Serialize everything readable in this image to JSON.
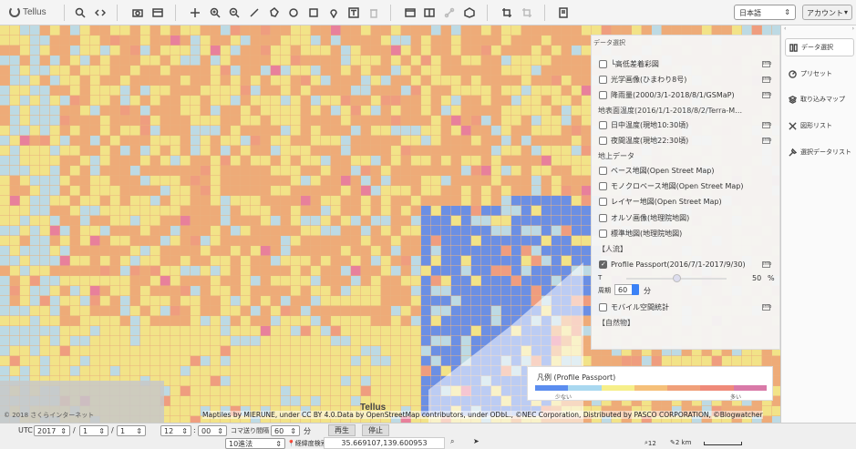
{
  "app": {
    "logo_text": "Tellus"
  },
  "toolbar": {
    "language": "日本語",
    "account": "アカウント"
  },
  "panel": {
    "title": "データ選択",
    "items": [
      {
        "label": "└高低差着彩図",
        "checked": false,
        "info": true
      },
      {
        "label": "光学画像(ひまわり8号)",
        "checked": false,
        "info": true
      },
      {
        "label": "降雨量(2000/3/1-2018/8/1/GSMaP)",
        "checked": false,
        "info": true
      }
    ],
    "section_surface_temp": "地表面温度(2016/1/1-2018/8/2/Terra-M…",
    "temp_items": [
      {
        "label": "日中温度(現地10:30頃)",
        "checked": false,
        "info": true
      },
      {
        "label": "夜間温度(現地22:30頃)",
        "checked": false,
        "info": true
      }
    ],
    "section_ground": "地上データ",
    "ground_items": [
      {
        "label": "ベース地図(Open Street Map)",
        "checked": false
      },
      {
        "label": "モノクロベース地図(Open Street Map)",
        "checked": false
      },
      {
        "label": "レイヤー地図(Open Street Map)",
        "checked": false
      },
      {
        "label": "オルソ画像(地理院地図)",
        "checked": false
      },
      {
        "label": "標準地図(地理院地図)",
        "checked": false
      }
    ],
    "section_people": "【人流】",
    "people_item": {
      "label": "Profile Passport(2016/7/1-2017/9/30)",
      "checked": true,
      "info": true
    },
    "opacity_label": "T",
    "opacity_value": "50",
    "opacity_unit": "%",
    "opacity_level": 0.5,
    "period_label": "周期",
    "period_value": "60",
    "period_unit": "分",
    "mobile_item": {
      "label": "モバイル空間統計",
      "checked": false,
      "info": true
    },
    "section_nature": "【自然物】"
  },
  "legend": {
    "title": "凡例 (Profile Passport)",
    "min_label": "少ない",
    "max_label": "多い",
    "colors": [
      "#5b8def",
      "#a9d8f0",
      "#f6ef8a",
      "#f5c07a",
      "#f0a07a",
      "#ef8a7a",
      "#d97aa8"
    ]
  },
  "sidebar": {
    "items": [
      {
        "label": "データ選択",
        "icon": "data-select-icon"
      },
      {
        "label": "プリセット",
        "icon": "preset-icon"
      },
      {
        "label": "取り込みマップ",
        "icon": "layers-icon"
      },
      {
        "label": "図形リスト",
        "icon": "shape-list-icon"
      },
      {
        "label": "選択データリスト",
        "icon": "pin-list-icon"
      }
    ]
  },
  "map": {
    "copyright": "© 2018 さくらインターネット",
    "attribution": "Maptiles by MIERUNE, under CC BY 4.0.Data by OpenStreetMap contributors, under ODbL., ©NEC Corporation, Distributed by PASCO CORPORATION, ©Blogwatcher",
    "watermark": "Tellus"
  },
  "bottom": {
    "utc": "UTC",
    "year": "2017",
    "month": "1",
    "day": "1",
    "hour": "12",
    "minute": "00",
    "frame_label": "コマ送り間隔",
    "frame_value": "60",
    "frame_unit": "分",
    "play": "再生",
    "stop": "停止",
    "coord_format": "10進法",
    "coord_search_label": "経緯度検索",
    "coord_value": "35.669107,139.600953",
    "zoom": "12",
    "scale": "2 km"
  },
  "colors": {
    "orange": "#eeaa78",
    "yellow": "#f3e88a",
    "lightblue": "#b8def0",
    "blue": "#5d8bef",
    "pink": "#e87a9e",
    "salmon": "#f09a80"
  }
}
